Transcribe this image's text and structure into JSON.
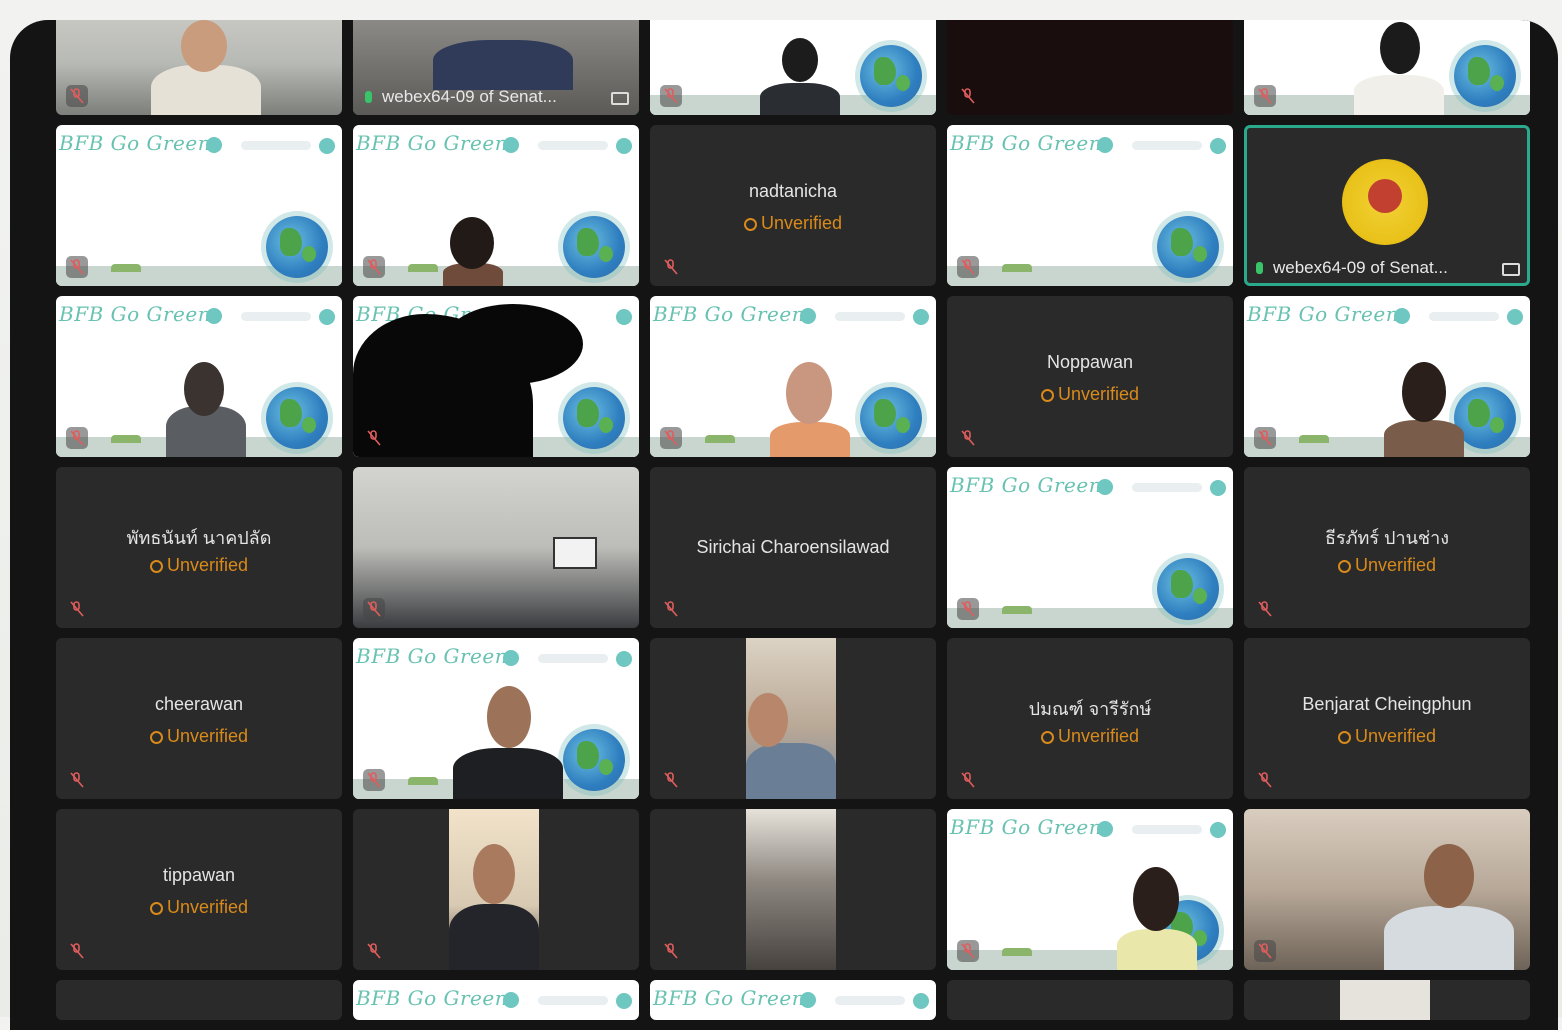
{
  "meeting": {
    "brand_text": "BFB Go Green",
    "unverified_label": "Unverified",
    "host_label": "webex64-09 of Senat..."
  },
  "tiles": {
    "nadtanicha": "nadtanicha",
    "noppawan": "Noppawan",
    "phatthanan": "พัทธนันท์ นาคปลัด",
    "sirichai": "Sirichai Charoensilawad",
    "theraphat": "ธีรภัทร์ ปานช่าง",
    "cheerawan": "cheerawan",
    "pamanut": "ปมณฑ์ จารีรักษ์",
    "benjarat": "Benjarat Cheingphun",
    "tippawan": "tippawan"
  },
  "colors": {
    "accent_active": "#2aa98c",
    "unverified": "#d88a1a",
    "tile_bg": "#2a2a2a",
    "brand_text": "#68c2b1"
  }
}
